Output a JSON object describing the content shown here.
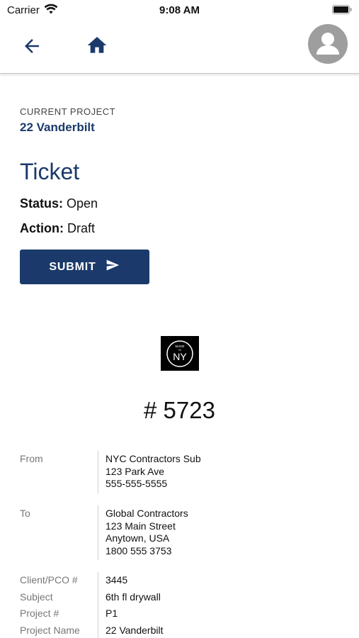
{
  "status_bar": {
    "carrier": "Carrier",
    "time": "9:08 AM"
  },
  "nav": {
    "back_icon": "arrow-left-icon",
    "home_icon": "home-icon",
    "avatar_icon": "user-avatar-icon"
  },
  "project": {
    "label": "CURRENT PROJECT",
    "name": "22 Vanderbilt"
  },
  "ticket": {
    "title": "Ticket",
    "status_label": "Status:",
    "status_value": "Open",
    "action_label": "Action:",
    "action_value": "Draft",
    "submit_label": "SUBMIT",
    "number": "# 5723"
  },
  "logo": {
    "text_top": "MADE",
    "text_mid": "IN",
    "text_main": "NY"
  },
  "details": {
    "from_label": "From",
    "from_lines": [
      "NYC Contractors Sub",
      "123 Park Ave",
      "555-555-5555"
    ],
    "to_label": "To",
    "to_lines": [
      "Global Contractors",
      "123 Main Street",
      "Anytown, USA",
      "1800 555 3753"
    ],
    "client_pco_label": "Client/PCO #",
    "client_pco_value": "3445",
    "subject_label": "Subject",
    "subject_value": "6th fl drywall",
    "project_num_label": "Project #",
    "project_num_value": "P1",
    "project_name_label": "Project Name",
    "project_name_value": "22 Vanderbilt"
  },
  "colors": {
    "brand": "#1b3a6b",
    "avatar_gray": "#9e9e9e"
  }
}
